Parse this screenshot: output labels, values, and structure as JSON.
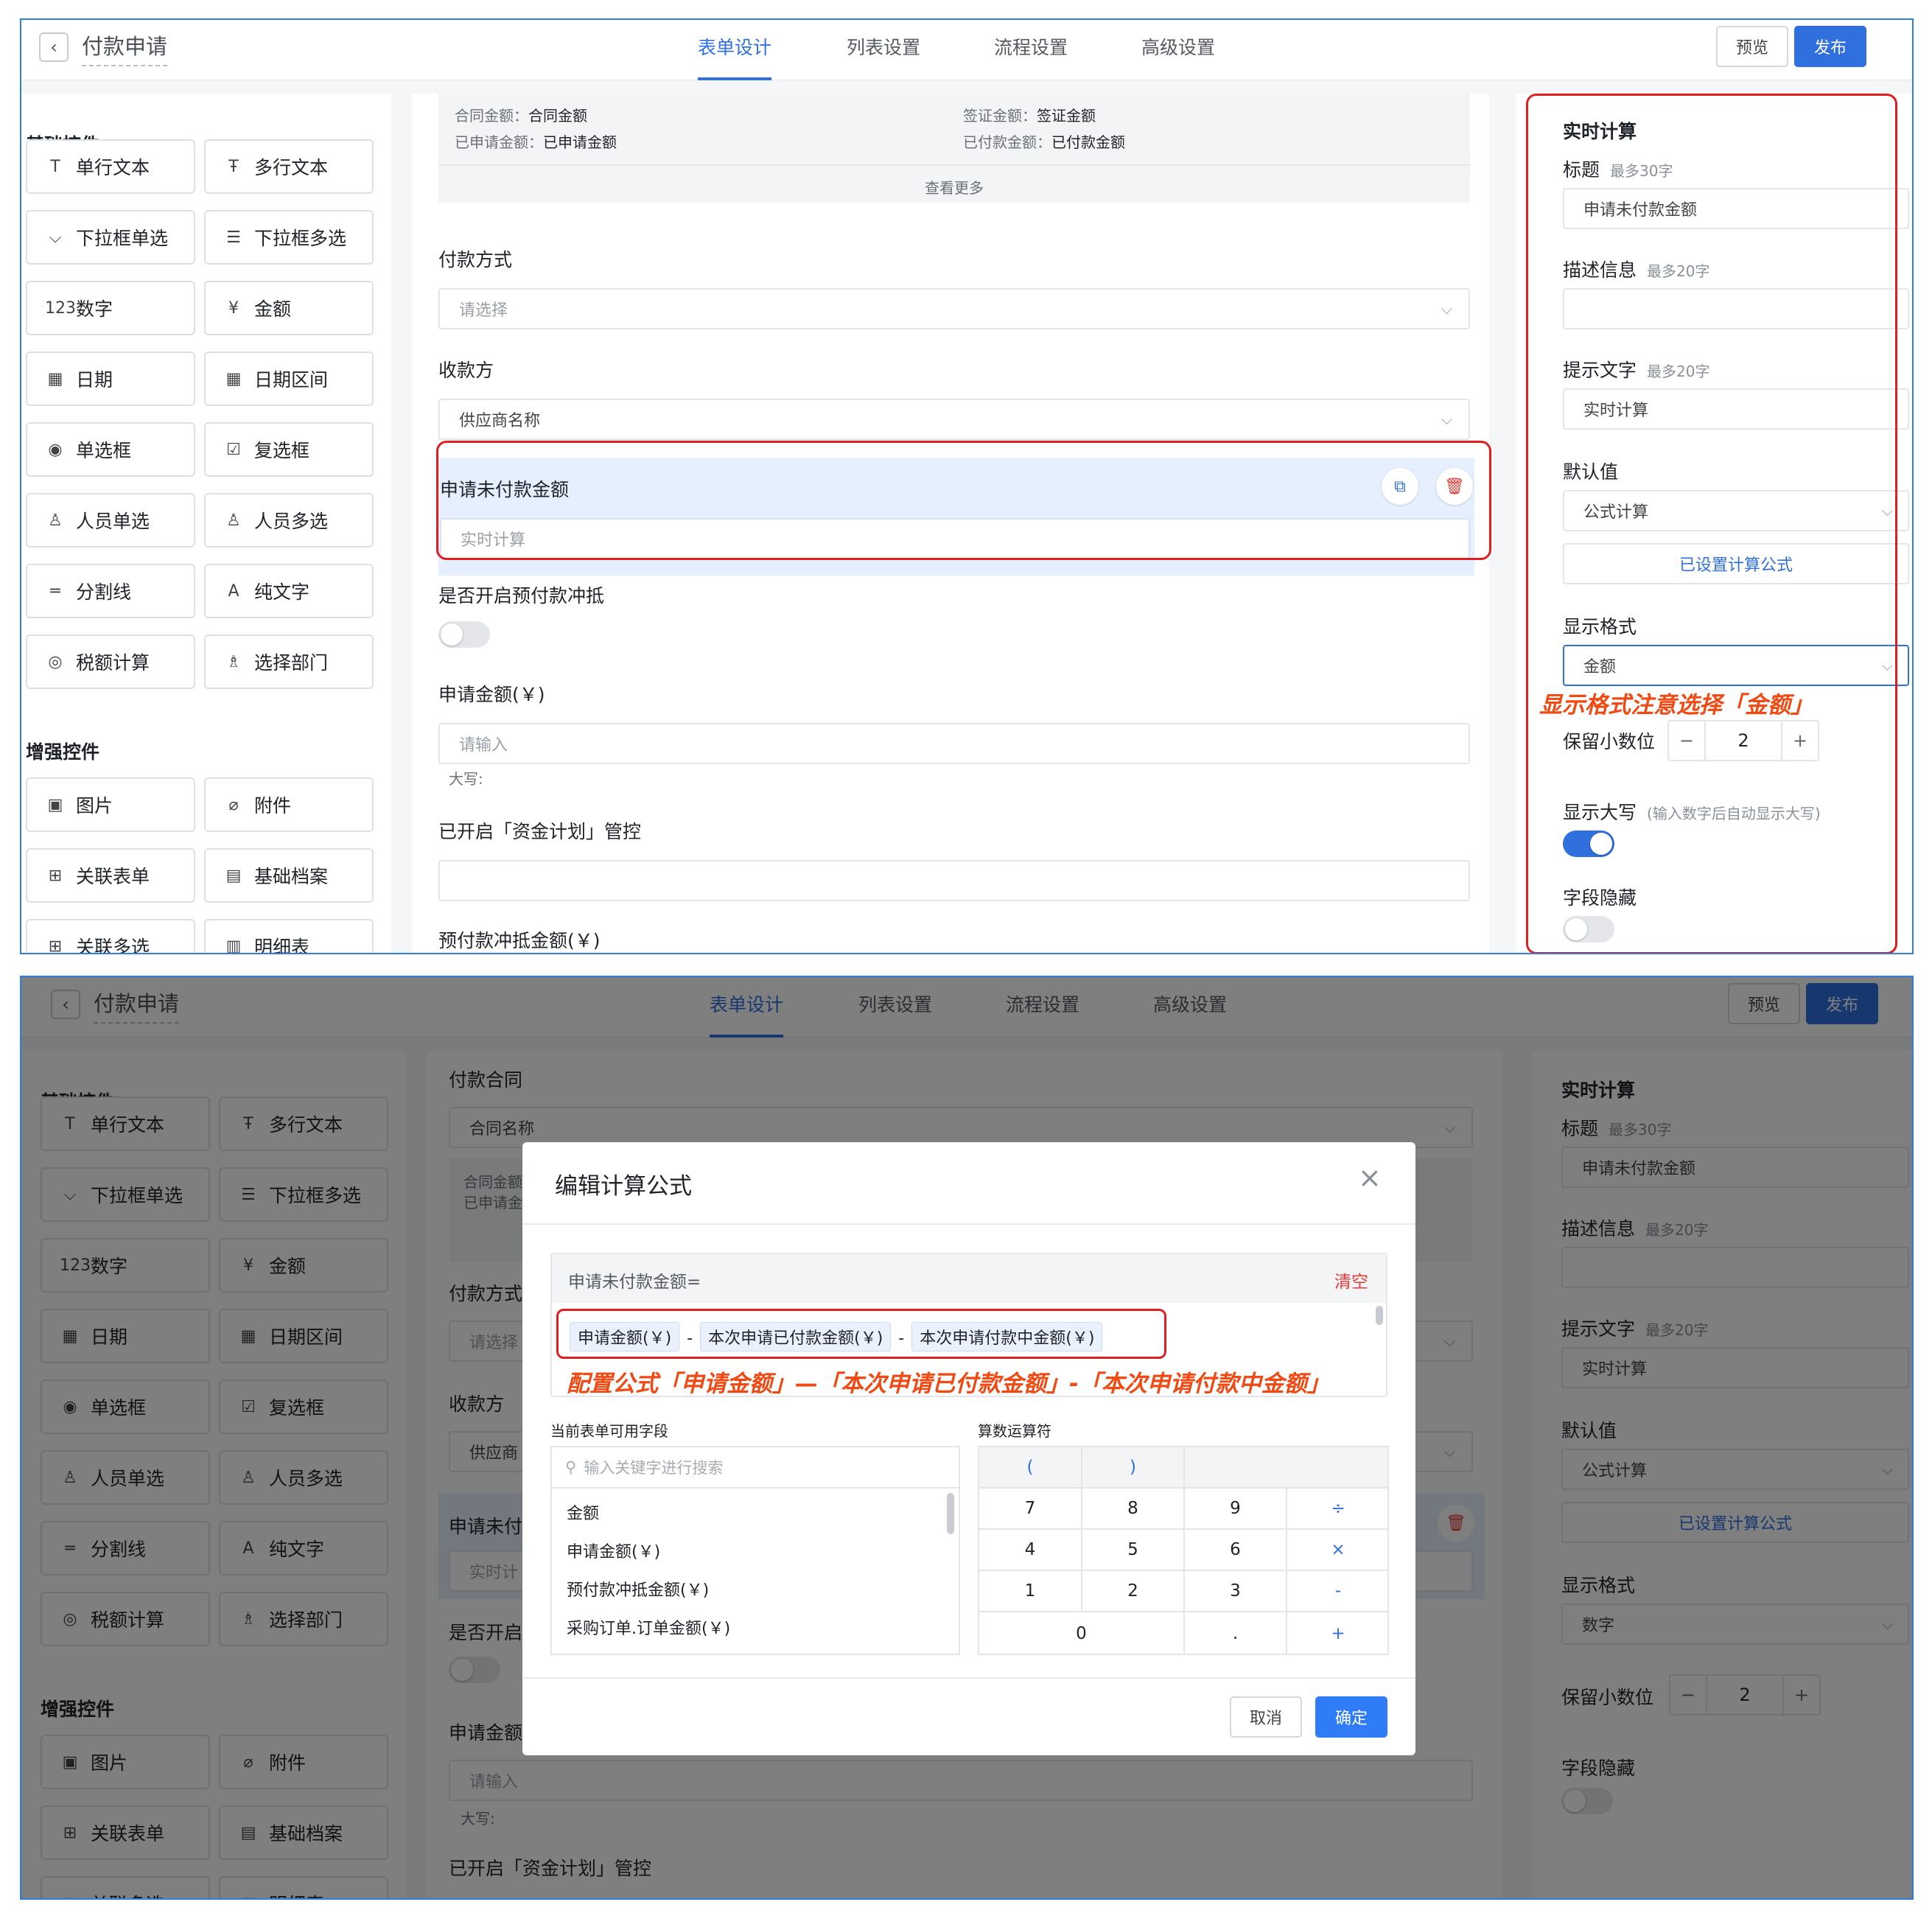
{
  "header": {
    "title": "付款申请",
    "tabs": [
      "表单设计",
      "列表设置",
      "流程设置",
      "高级设置"
    ],
    "preview": "预览",
    "publish": "发布"
  },
  "left_panel": {
    "basic_title": "基础控件",
    "enhanced_title": "增强控件",
    "basic": [
      {
        "icon": "text-icon",
        "label": "单行文本"
      },
      {
        "icon": "textarea-icon",
        "label": "多行文本"
      },
      {
        "icon": "dropdown-icon",
        "label": "下拉框单选"
      },
      {
        "icon": "multi-dropdown-icon",
        "label": "下拉框多选"
      },
      {
        "icon": "number-icon",
        "label": "数字"
      },
      {
        "icon": "currency-icon",
        "label": "金额"
      },
      {
        "icon": "calendar-icon",
        "label": "日期"
      },
      {
        "icon": "date-range-icon",
        "label": "日期区间"
      },
      {
        "icon": "radio-icon",
        "label": "单选框"
      },
      {
        "icon": "checkbox-icon",
        "label": "复选框"
      },
      {
        "icon": "user-icon",
        "label": "人员单选"
      },
      {
        "icon": "users-icon",
        "label": "人员多选"
      },
      {
        "icon": "divider-icon",
        "label": "分割线"
      },
      {
        "icon": "plain-text-icon",
        "label": "纯文字"
      },
      {
        "icon": "tax-icon",
        "label": "税额计算"
      },
      {
        "icon": "org-icon",
        "label": "选择部门"
      }
    ],
    "enhanced": [
      {
        "icon": "image-icon",
        "label": "图片"
      },
      {
        "icon": "attachment-icon",
        "label": "附件"
      },
      {
        "icon": "link-form-icon",
        "label": "关联表单"
      },
      {
        "icon": "archive-icon",
        "label": "基础档案"
      },
      {
        "icon": "link-multi-icon",
        "label": "关联多选"
      },
      {
        "icon": "detail-table-icon",
        "label": "明细表"
      }
    ]
  },
  "form_a": {
    "summary": [
      {
        "key": "合同金额：",
        "val": "合同金额"
      },
      {
        "key": "签证金额：",
        "val": "签证金额"
      },
      {
        "key": "已申请金额：",
        "val": "已申请金额"
      },
      {
        "key": "已付款金额：",
        "val": "已付款金额"
      }
    ],
    "view_more": "查看更多",
    "payment_method_label": "付款方式",
    "payment_method_placeholder": "请选择",
    "payee_label": "收款方",
    "payee_value": "供应商名称",
    "selected_field_label": "申请未付款金额",
    "selected_field_placeholder": "实时计算",
    "prepay_offset_label": "是否开启预付款冲抵",
    "apply_amount_label": "申请金额(￥)",
    "apply_amount_placeholder": "请输入",
    "uppercase_label": "大写:",
    "fund_plan_label": "已开启「资金计划」管控",
    "prepay_amount_label": "预付款冲抵金额(￥)"
  },
  "form_b": {
    "contract_label": "付款合同",
    "contract_placeholder": "合同名称",
    "summary_1": "合同金额",
    "summary_2": "已申请金",
    "payment_method_label": "付款方式",
    "payment_method_placeholder": "请选择",
    "payee_label": "收款方",
    "payee_value": "供应商",
    "selected_field_label": "申请未付",
    "selected_field_placeholder": "实时计",
    "prepay_offset_label": "是否开启",
    "apply_amount_label": "申请金额",
    "apply_amount_placeholder": "请输入",
    "uppercase_label": "大写:",
    "fund_plan_label": "已开启「资金计划」管控"
  },
  "right_a": {
    "section": "实时计算",
    "title_label": "标题",
    "title_hint": "最多30字",
    "title_value": "申请未付款金额",
    "desc_label": "描述信息",
    "desc_hint": "最多20字",
    "tip_label": "提示文字",
    "tip_hint": "最多20字",
    "tip_value": "实时计算",
    "default_label": "默认值",
    "default_value": "公式计算",
    "formula_set": "已设置计算公式",
    "format_label": "显示格式",
    "format_value": "金额",
    "decimals_label": "保留小数位",
    "decimals_value": "2",
    "uppercase_label": "显示大写",
    "uppercase_hint": "(输入数字后自动显示大写)",
    "hidden_label": "字段隐藏",
    "minus_sign": "−",
    "plus_sign": "+"
  },
  "right_b": {
    "section": "实时计算",
    "title_label": "标题",
    "title_hint": "最多30字",
    "title_value": "申请未付款金额",
    "desc_label": "描述信息",
    "desc_hint": "最多20字",
    "tip_label": "提示文字",
    "tip_hint": "最多20字",
    "tip_value": "实时计算",
    "default_label": "默认值",
    "default_value": "公式计算",
    "formula_set": "已设置计算公式",
    "format_label": "显示格式",
    "format_value": "数字",
    "decimals_label": "保留小数位",
    "decimals_value": "2",
    "hidden_label": "字段隐藏",
    "minus_sign": "−",
    "plus_sign": "+"
  },
  "annotations": {
    "format_note": "显示格式注意选择「金额」",
    "formula_note": "配置公式「申请金额」—「本次申请已付款金额」-「本次申请付款中金额」"
  },
  "modal": {
    "title": "编辑计算公式",
    "formula_prefix": "申请未付款金额=",
    "clear": "清空",
    "tokens": [
      "申请金额(￥)",
      "本次申请已付款金额(￥)",
      "本次申请付款中金额(￥)"
    ],
    "operator_minus": "-",
    "fields_title": "当前表单可用字段",
    "ops_title": "算数运算符",
    "search_placeholder": "输入关键字进行搜索",
    "fields": [
      "金额",
      "申请金额(￥)",
      "预付款冲抵金额(￥)",
      "采购订单.订单金额(￥)"
    ],
    "ops": [
      "(",
      ")",
      "7",
      "8",
      "9",
      "÷",
      "4",
      "5",
      "6",
      "×",
      "1",
      "2",
      "3",
      "-",
      "0",
      ".",
      "+"
    ],
    "cancel": "取消",
    "confirm": "确定"
  },
  "colors": {
    "accent": "#2f6fde",
    "annotation": "#f04a14",
    "highlight_border": "#e02020",
    "danger": "#e53935"
  }
}
